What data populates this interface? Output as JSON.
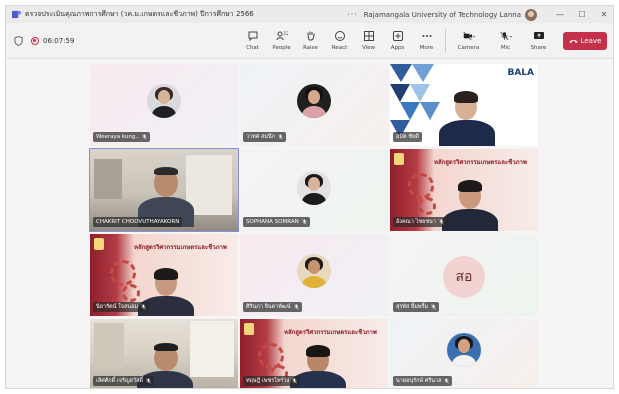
{
  "window": {
    "title": "ตรวจประเมินคุณภาพการศึกษา (วค.ม.เกษตรและชีวภาพ) ปีการศึกษา 2566",
    "more": "···",
    "organization": "Rajamangala University of Technology Lanna",
    "min": "—",
    "max": "☐",
    "close": "✕"
  },
  "toolbar": {
    "timer": "06:07:59",
    "chat": "Chat",
    "people_count": "12",
    "people": "People",
    "raise": "Raise",
    "react": "React",
    "view": "View",
    "apps": "Apps",
    "more": "More",
    "camera": "Camera",
    "mic": "Mic",
    "share": "Share",
    "leave": "Leave"
  },
  "participants": [
    {
      "name": "Weeraya kung.."
    },
    {
      "name": "วาทศ สมนึก"
    },
    {
      "name": "สมิต ชัยดี"
    },
    {
      "name": "CHAKRIT CHOOVUTHAYAKORN"
    },
    {
      "name": "SOPHANA SOMRAN"
    },
    {
      "name": "อังคณา ไชยชนา"
    },
    {
      "name": "นิยารัตน์ ใจสนอม"
    },
    {
      "name": "ศิรินภา จินดาพัฒน์"
    },
    {
      "name": "สุรพัส ยิ้มพริ้ม"
    },
    {
      "name": "เลิศศักดิ์ เจริญสวัสดิ์"
    },
    {
      "name": "ทฤษฎี เพชรไพร่วง"
    },
    {
      "name": "นายอนุรักษ์ ศรีนวล"
    }
  ],
  "tiles": {
    "course_title": "หลักสูตรวิศวกรรมเกษตรและชีวภาพ",
    "initials": "สอ",
    "bala": "BALA"
  }
}
